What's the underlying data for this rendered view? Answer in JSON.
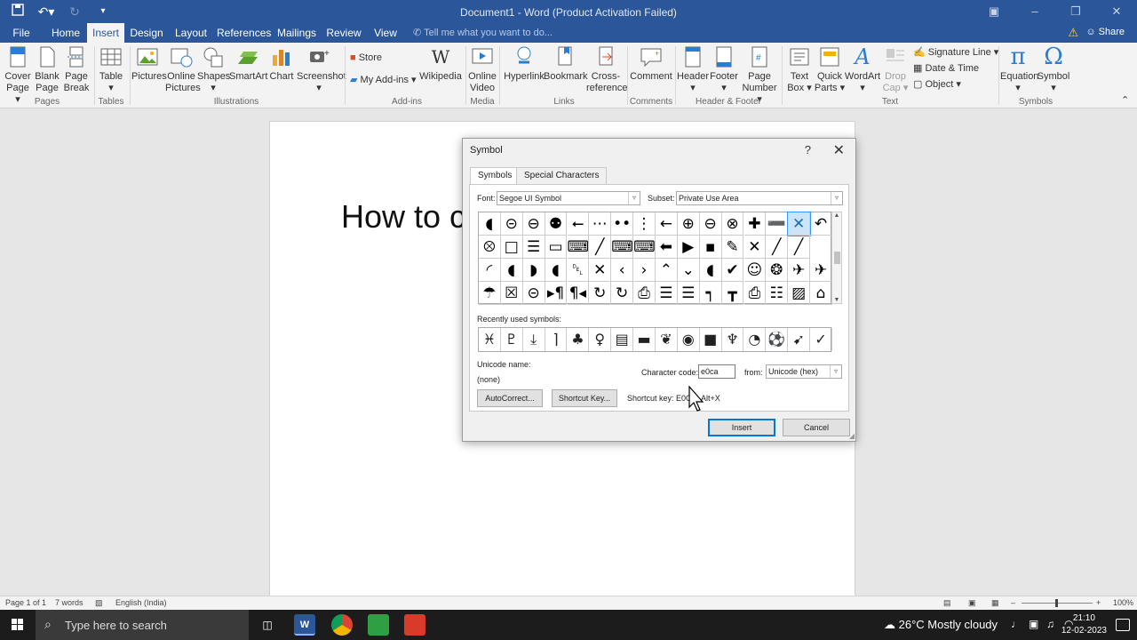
{
  "titlebar": {
    "title": "Document1 - Word (Product Activation Failed)",
    "save_icon": "save-icon",
    "undo_icon": "undo-icon",
    "redo_icon": "redo-icon"
  },
  "tabs": [
    "File",
    "Home",
    "Insert",
    "Design",
    "Layout",
    "References",
    "Mailings",
    "Review",
    "View"
  ],
  "active_tab": "Insert",
  "tell_me": "Tell me what you want to do...",
  "share": "Share",
  "ribbon": {
    "cover_page": [
      "Cover",
      "Page ▾"
    ],
    "blank_page": [
      "Blank",
      "Page"
    ],
    "page_break": [
      "Page",
      "Break"
    ],
    "table": [
      "Table",
      "▾"
    ],
    "pictures": "Pictures",
    "online_pictures": [
      "Online",
      "Pictures"
    ],
    "shapes": [
      "Shapes",
      "▾"
    ],
    "smartart": "SmartArt",
    "chart": "Chart",
    "screenshot": [
      "Screenshot",
      "▾"
    ],
    "store": "Store",
    "my_addins": "My Add-ins",
    "wikipedia": "Wikipedia",
    "online_video": [
      "Online",
      "Video"
    ],
    "hyperlink": "Hyperlink",
    "bookmark": "Bookmark",
    "cross_reference": [
      "Cross-",
      "reference"
    ],
    "comment": "Comment",
    "header": [
      "Header",
      "▾"
    ],
    "footer": [
      "Footer",
      "▾"
    ],
    "page_number": [
      "Page",
      "Number ▾"
    ],
    "text_box": [
      "Text",
      "Box ▾"
    ],
    "quick_parts": [
      "Quick",
      "Parts ▾"
    ],
    "wordart": [
      "WordArt",
      "▾"
    ],
    "drop_cap": [
      "Drop",
      "Cap ▾"
    ],
    "signature_line": "Signature Line",
    "date_time": "Date & Time",
    "object": "Object",
    "equation": [
      "Equation",
      "▾"
    ],
    "symbol": [
      "Symbol",
      "▾"
    ],
    "groups": [
      "Pages",
      "Tables",
      "Illustrations",
      "Add-ins",
      "Media",
      "Links",
      "Comments",
      "Header & Footer",
      "Text",
      "Symbols"
    ]
  },
  "document": {
    "text": "How to c"
  },
  "dialog": {
    "title": "Symbol",
    "help": "?",
    "close": "✕",
    "tabs": [
      "Symbols",
      "Special Characters"
    ],
    "font_label": "Font:",
    "font_value": "Segoe UI Symbol",
    "subset_label": "Subset:",
    "subset_value": "Private Use Area",
    "symbols_rows": [
      [
        "◖",
        "⊝",
        "⊖",
        "⚉",
        "⭠",
        "⋯",
        "••",
        "⋮",
        "←",
        "⊕",
        "⊖",
        "⊗",
        "✚",
        "➖",
        "✕",
        "↶"
      ],
      [
        "⮾",
        "□",
        "☰",
        "▭",
        "⌨",
        "╱",
        "⌨",
        "⌨",
        "⬅",
        "▶",
        "▪",
        "✎",
        "✕",
        "╱",
        "╱"
      ],
      [
        "◜",
        "◖",
        "◗",
        "◖",
        "␡",
        "✕",
        "‹",
        "›",
        "⌃",
        "⌄",
        "◖",
        "✔",
        "☺",
        "❂",
        "✈",
        "✈"
      ],
      [
        "☂",
        "☒",
        "⊝",
        "▸¶",
        "¶◂",
        "↻",
        "↻",
        "⎙",
        "☰",
        "☰",
        "┑",
        "┳",
        "⎙",
        "☷",
        "▨",
        "⌂"
      ]
    ],
    "selected_row": 0,
    "selected_col": 14,
    "recently_label": "Recently used symbols:",
    "recent": [
      "♓",
      "♇",
      "⤓",
      "⌉",
      "♣",
      "♀",
      "▤",
      "▬",
      "❦",
      "◉",
      "■",
      "♆",
      "◔",
      "⚽",
      "➹",
      "✓"
    ],
    "unicode_name_label": "Unicode name:",
    "unicode_name_value": "(none)",
    "char_code_label": "Character code:",
    "char_code_value": "e0ca",
    "from_label": "from:",
    "from_value": "Unicode (hex)",
    "autocorrect": "AutoCorrect...",
    "shortcut_key_btn": "Shortcut Key...",
    "shortcut_key_text": "Shortcut key: E0CA, Alt+X",
    "insert": "Insert",
    "cancel": "Cancel"
  },
  "statusbar": {
    "page": "Page 1 of 1",
    "words": "7 words",
    "language": "English (India)",
    "zoom": "100%"
  },
  "taskbar": {
    "search_placeholder": "Type here to search",
    "weather": "26°C  Mostly cloudy",
    "time": "21:10",
    "date": "12-02-2023"
  }
}
